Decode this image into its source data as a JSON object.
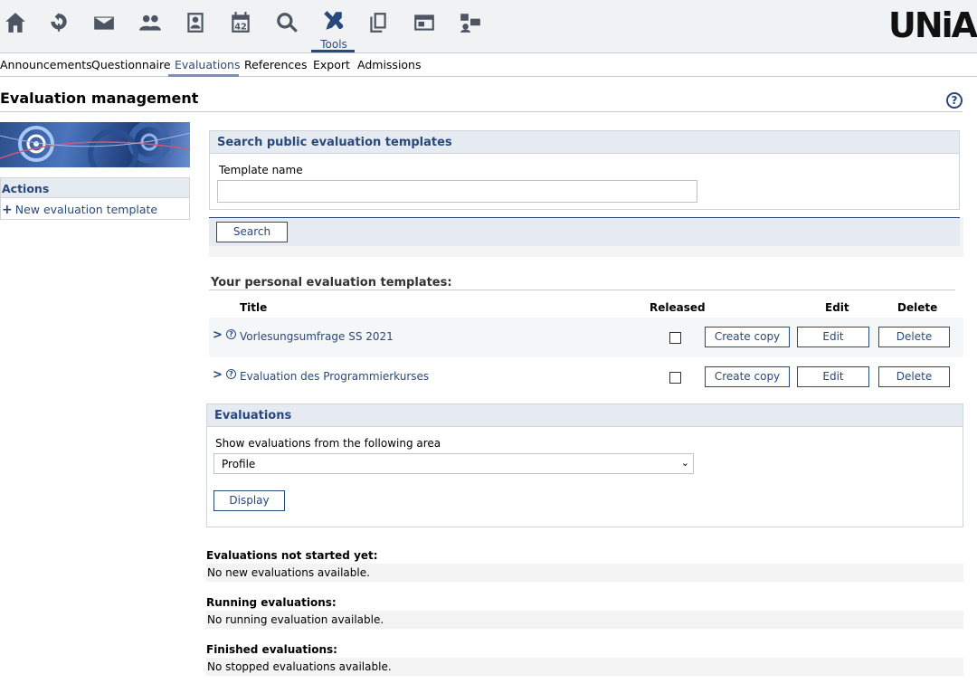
{
  "nav": {
    "icons": [
      "home-icon",
      "activity-icon",
      "mail-icon",
      "community-icon",
      "profile-icon",
      "calendar-icon",
      "search-icon",
      "tools-icon",
      "files-icon",
      "admin-icon",
      "chat-icon"
    ],
    "active_label": "Tools",
    "logo_text": "UNiA"
  },
  "tabs": [
    {
      "label": "Announcements"
    },
    {
      "label": "Questionnaire"
    },
    {
      "label": "Evaluations",
      "active": true
    },
    {
      "label": "References"
    },
    {
      "label": "Export"
    },
    {
      "label": "Admissions"
    }
  ],
  "page": {
    "title": "Evaluation management",
    "help_glyph": "?"
  },
  "sidebar": {
    "actions_title": "Actions",
    "new_template_label": "New evaluation template"
  },
  "search_panel": {
    "title": "Search public evaluation templates",
    "template_name_label": "Template name",
    "template_name_value": "",
    "search_button": "Search"
  },
  "personal_templates": {
    "heading": "Your personal evaluation templates:",
    "columns": {
      "title": "Title",
      "released": "Released",
      "edit": "Edit",
      "delete": "Delete"
    },
    "rows": [
      {
        "title": "Vorlesungsumfrage SS 2021",
        "released": false,
        "copy_label": "Create copy",
        "edit_label": "Edit",
        "delete_label": "Delete"
      },
      {
        "title": "Evaluation des Programmierkurses",
        "released": false,
        "copy_label": "Create copy",
        "edit_label": "Edit",
        "delete_label": "Delete"
      }
    ]
  },
  "evaluations_panel": {
    "title": "Evaluations",
    "area_label": "Show evaluations from the following area",
    "area_selected": "Profile",
    "display_button": "Display"
  },
  "status_sections": [
    {
      "heading": "Evaluations not started yet:",
      "message": "No new evaluations available."
    },
    {
      "heading": "Running evaluations:",
      "message": "No running evaluation available."
    },
    {
      "heading": "Finished evaluations:",
      "message": "No stopped evaluations available."
    }
  ],
  "colors": {
    "accent": "#28497c",
    "header_bg": "#e6ebf2",
    "topbar_bg": "#f1f2f4",
    "icon_gray": "#4d5563"
  }
}
